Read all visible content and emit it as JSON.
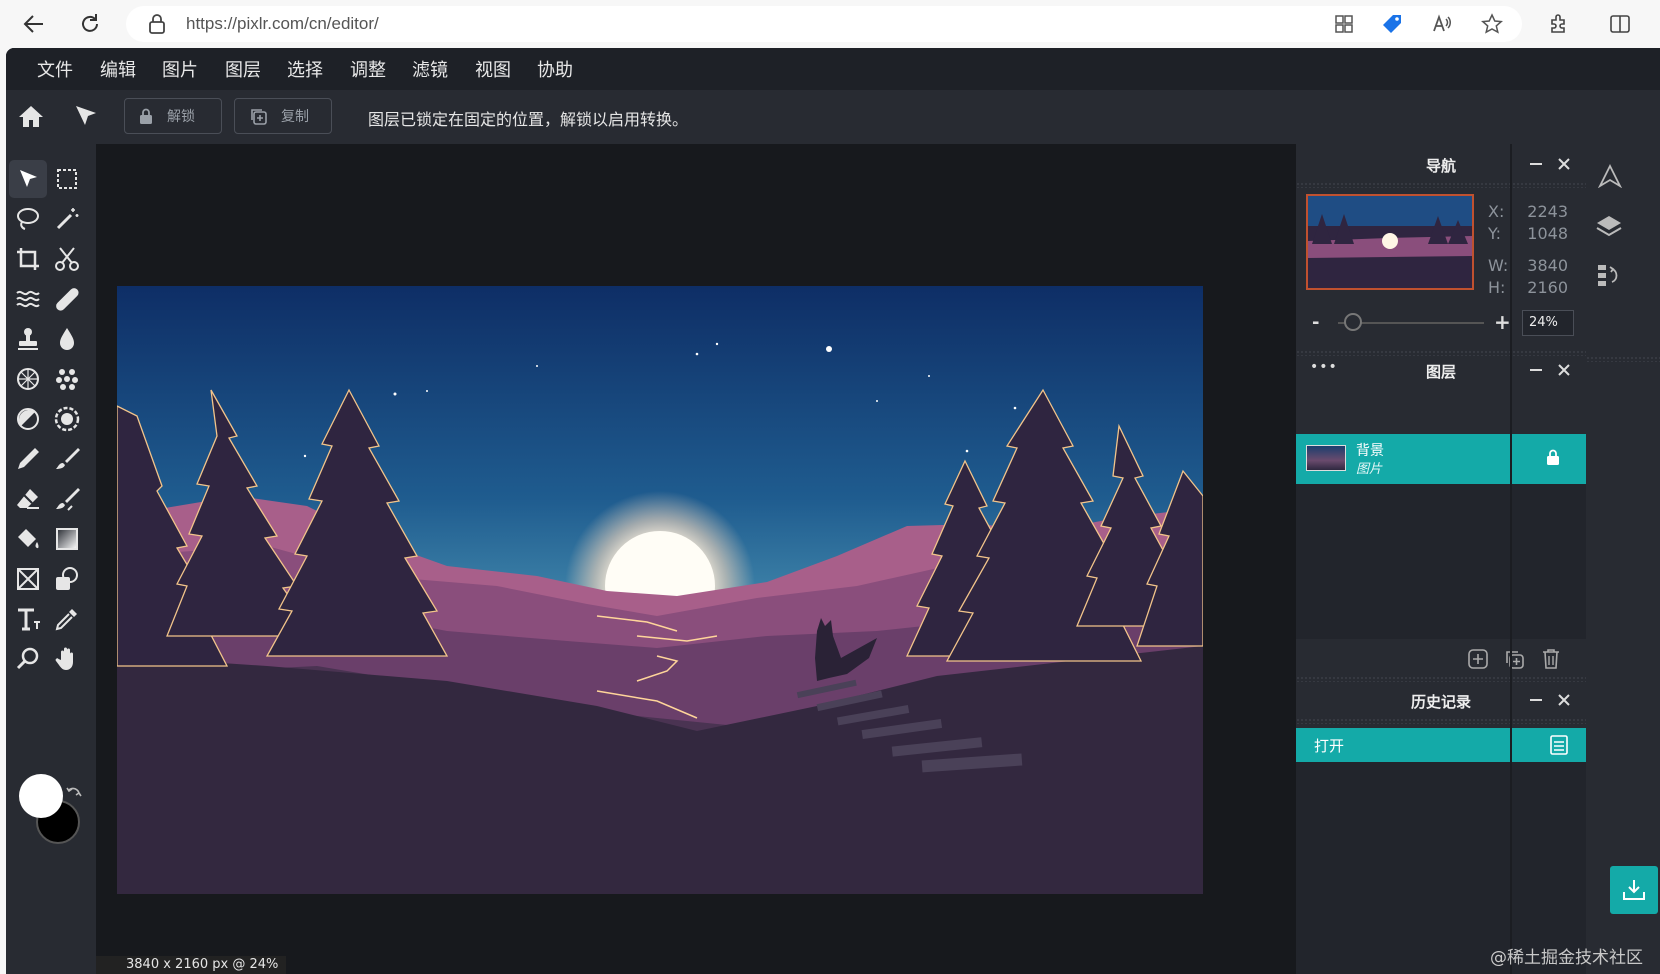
{
  "browser": {
    "url": "https://pixlr.com/cn/editor/"
  },
  "menu": [
    "文件",
    "编辑",
    "图片",
    "图层",
    "选择",
    "调整",
    "滤镜",
    "视图",
    "协助"
  ],
  "toolbar": {
    "unlock_label": "解锁",
    "copy_label": "复制",
    "message": "图层已锁定在固定的位置，解锁以启用转换。"
  },
  "status": "3840 x 2160 px @ 24%",
  "navigator": {
    "title": "导航",
    "x_label": "X:",
    "x_value": "2243",
    "y_label": "Y:",
    "y_value": "1048",
    "w_label": "W:",
    "w_value": "3840",
    "h_label": "H:",
    "h_value": "2160",
    "zoom_minus": "-",
    "zoom_plus": "+",
    "zoom_value": "24%",
    "zoom_level": 0.24
  },
  "layers": {
    "more": "•••",
    "title": "图层",
    "items": [
      {
        "name": "背景",
        "type": "图片",
        "locked": true
      }
    ]
  },
  "history": {
    "title": "历史记录",
    "items": [
      "打开"
    ]
  },
  "colors": {
    "accent": "#14aaa8",
    "foreground": "#ffffff",
    "background": "#000000"
  },
  "watermark": "@稀土掘金技术社区"
}
